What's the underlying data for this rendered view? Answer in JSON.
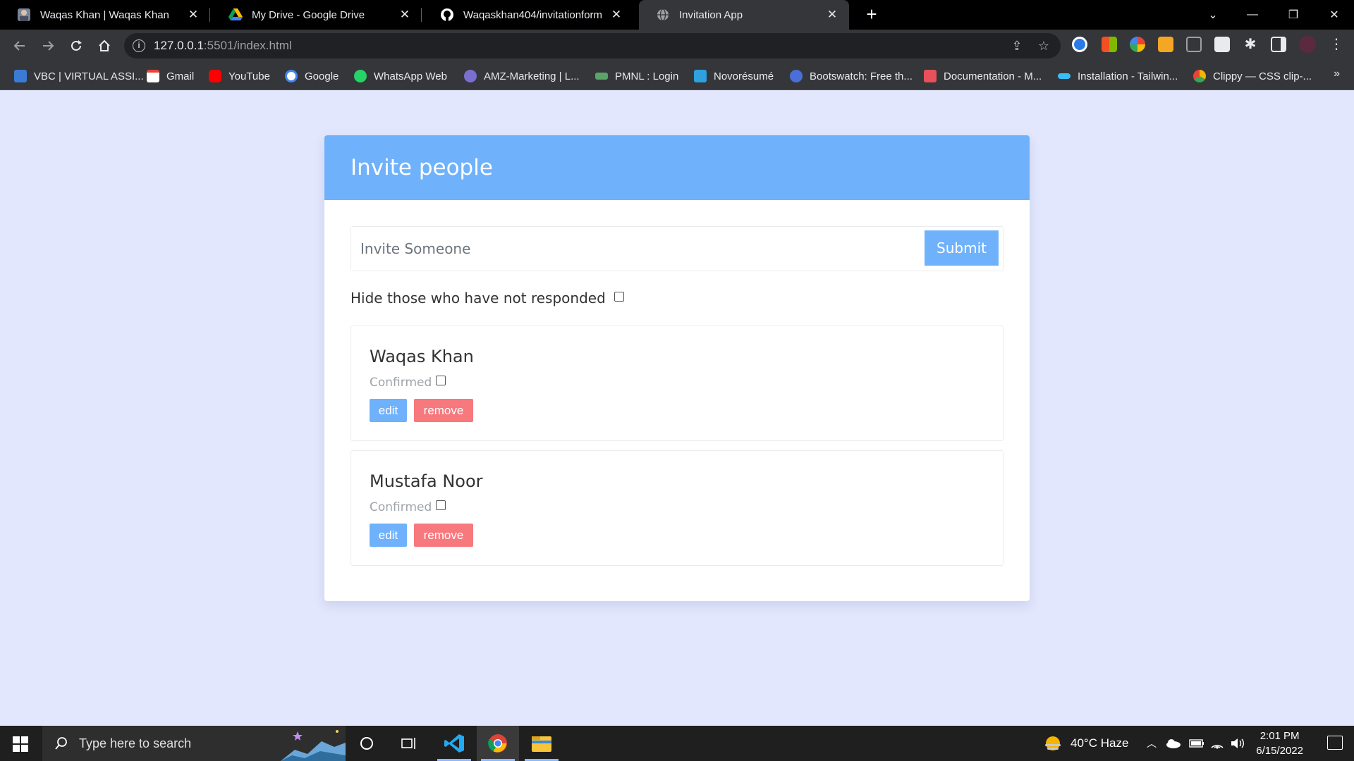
{
  "browser": {
    "tabs": [
      {
        "title": "Waqas Khan | Waqas Khan",
        "icon": "avatar-favicon"
      },
      {
        "title": "My Drive - Google Drive",
        "icon": "google-drive-icon"
      },
      {
        "title": "Waqaskhan404/invitationform",
        "icon": "github-icon"
      },
      {
        "title": "Invitation App",
        "icon": "globe-icon"
      }
    ],
    "address": {
      "host": "127.0.0.1",
      "rest": ":5501/index.html"
    },
    "bookmarks": [
      {
        "label": "VBC | VIRTUAL ASSI...",
        "color": "#3a7bd5"
      },
      {
        "label": "Gmail",
        "color": "#ea4335"
      },
      {
        "label": "YouTube",
        "color": "#ff0000"
      },
      {
        "label": "Google",
        "color": "#ffffff"
      },
      {
        "label": "WhatsApp Web",
        "color": "#25d366"
      },
      {
        "label": "AMZ-Marketing | L...",
        "color": "#7a6fd0"
      },
      {
        "label": "PMNL : Login",
        "color": "#5aa469"
      },
      {
        "label": "Novorésumé",
        "color": "#2ea1de"
      },
      {
        "label": "Bootswatch: Free th...",
        "color": "#4a6fd8"
      },
      {
        "label": "Documentation - M...",
        "color": "#e8505b"
      },
      {
        "label": "Installation - Tailwin...",
        "color": "#38bdf8"
      },
      {
        "label": "Clippy — CSS clip-...",
        "color": "#f4b400"
      }
    ]
  },
  "app": {
    "header": "Invite people",
    "form": {
      "placeholder": "Invite Someone",
      "submit": "Submit"
    },
    "filter_label": "Hide those who have not responded",
    "invitees": [
      {
        "name": "Waqas Khan",
        "status": "Confirmed",
        "edit": "edit",
        "remove": "remove"
      },
      {
        "name": "Mustafa Noor",
        "status": "Confirmed",
        "edit": "edit",
        "remove": "remove"
      }
    ],
    "accent": "#6fb2fb",
    "danger": "#f7787d"
  },
  "taskbar": {
    "search_placeholder": "Type here to search",
    "weather": "40°C  Haze",
    "time": "2:01 PM",
    "date": "6/15/2022"
  }
}
